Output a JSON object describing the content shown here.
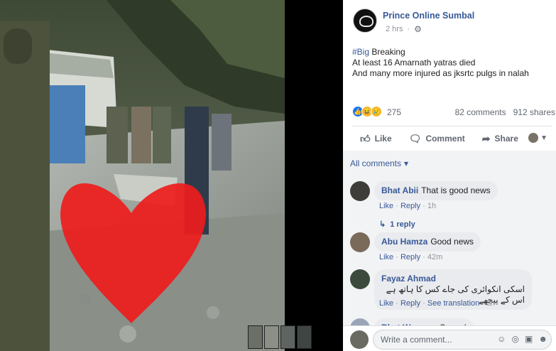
{
  "post": {
    "page_name": "Prince Online Sumbal",
    "time": "2 hrs",
    "hashtag": "#Big",
    "line1_rest": " Breaking",
    "line2": "At least 16 Amarnath yatras died",
    "line3": "And many more injured as jksrtc pulgs in nalah",
    "reaction_count": "275",
    "comments_count": "82 comments",
    "shares_count": "912 shares"
  },
  "actions": {
    "like": "Like",
    "comment": "Comment",
    "share": "Share"
  },
  "comments": {
    "all_label": "All comments",
    "items": [
      {
        "name": "Bhat Abii",
        "text": "That is good news",
        "like": "Like",
        "reply": "Reply",
        "time": "1h"
      },
      {
        "name": "Abu Hamza",
        "text": "Good news",
        "like": "Like",
        "reply": "Reply",
        "time": "42m"
      },
      {
        "name": "Fayaz Ahmad",
        "text": "اسکی انکوائری کی جاے کس کا ہاتھ ہے اس کے پیچھے",
        "like": "Like",
        "reply": "Reply",
        "see_translation": "See translation",
        "time": "2h"
      },
      {
        "name": "Bhat Waseem",
        "text": "So sad"
      }
    ],
    "replies_label": "1 reply",
    "write_placeholder": "Write a comment..."
  },
  "icons": {
    "like": "thumbs-up-icon",
    "comment": "speech-bubble-icon",
    "share": "share-arrow-icon",
    "settings": "gear-icon",
    "emoji": "emoji-icon",
    "camera": "camera-icon",
    "gif": "gif-icon",
    "sticker": "sticker-icon"
  },
  "colors": {
    "link": "#385898",
    "like_blue": "#1877f2",
    "comment_bg": "#f2f3f5",
    "bubble_bg": "#e9ebee"
  }
}
